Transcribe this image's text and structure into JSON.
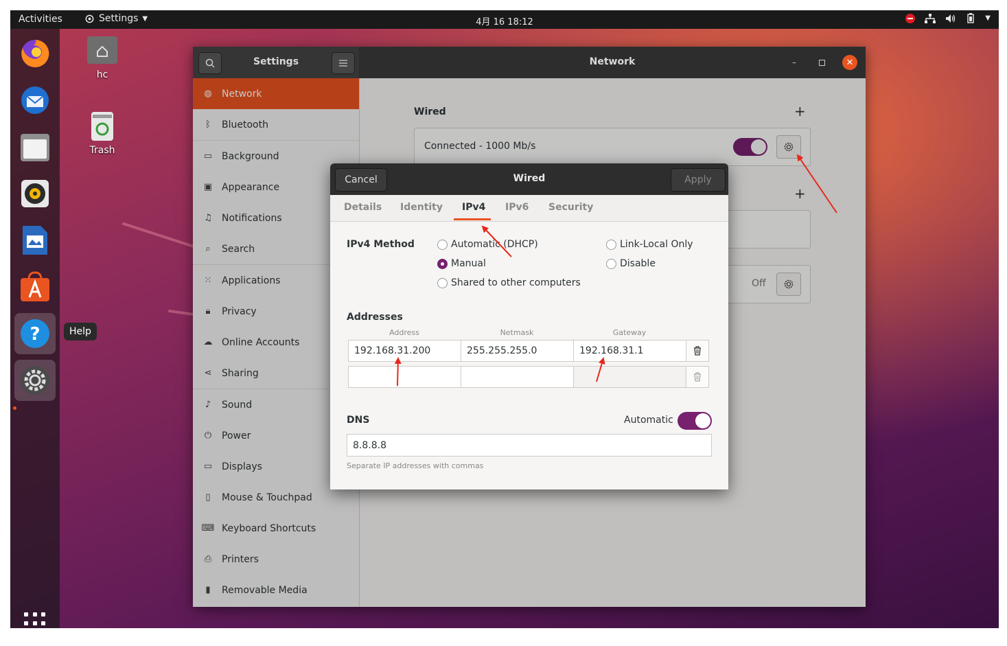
{
  "topbar": {
    "activities": "Activities",
    "app_menu": "Settings",
    "clock": "4月 16  18:12"
  },
  "dock": {
    "tooltip": "Help"
  },
  "desktop": {
    "home_label": "hc",
    "trash_label": "Trash"
  },
  "settings": {
    "sidebar_title": "Settings",
    "panel_title": "Network",
    "sidebar_items": [
      {
        "label": "Network",
        "icon": "network-icon"
      },
      {
        "label": "Bluetooth",
        "icon": "bluetooth-icon"
      },
      {
        "label": "Background",
        "icon": "background-icon"
      },
      {
        "label": "Appearance",
        "icon": "appearance-icon"
      },
      {
        "label": "Notifications",
        "icon": "bell-icon"
      },
      {
        "label": "Search",
        "icon": "search-icon"
      },
      {
        "label": "Applications",
        "icon": "apps-icon"
      },
      {
        "label": "Privacy",
        "icon": "lock-icon"
      },
      {
        "label": "Online Accounts",
        "icon": "cloud-icon"
      },
      {
        "label": "Sharing",
        "icon": "share-icon"
      },
      {
        "label": "Sound",
        "icon": "music-note-icon"
      },
      {
        "label": "Power",
        "icon": "power-icon"
      },
      {
        "label": "Displays",
        "icon": "display-icon"
      },
      {
        "label": "Mouse & Touchpad",
        "icon": "mouse-icon"
      },
      {
        "label": "Keyboard Shortcuts",
        "icon": "keyboard-icon"
      },
      {
        "label": "Printers",
        "icon": "printer-icon"
      },
      {
        "label": "Removable Media",
        "icon": "usb-icon"
      }
    ],
    "wired_title": "Wired",
    "wired_status": "Connected - 1000 Mb/s",
    "proxy_status": "Off"
  },
  "dialog": {
    "title": "Wired",
    "cancel": "Cancel",
    "apply": "Apply",
    "tabs": [
      "Details",
      "Identity",
      "IPv4",
      "IPv6",
      "Security"
    ],
    "active_tab": "IPv4",
    "ipv4_method_label": "IPv4 Method",
    "methods": {
      "automatic": "Automatic (DHCP)",
      "link_local": "Link-Local Only",
      "manual": "Manual",
      "disable": "Disable",
      "shared": "Shared to other computers"
    },
    "selected_method": "Manual",
    "addresses_label": "Addresses",
    "columns": {
      "address": "Address",
      "netmask": "Netmask",
      "gateway": "Gateway"
    },
    "rows": [
      {
        "address": "192.168.31.200",
        "netmask": "255.255.255.0",
        "gateway": "192.168.31.1"
      },
      {
        "address": "",
        "netmask": "",
        "gateway": ""
      }
    ],
    "dns_label": "DNS",
    "dns_automatic_label": "Automatic",
    "dns_value": "8.8.8.8",
    "dns_hint": "Separate IP addresses with commas"
  },
  "colors": {
    "accent": "#e95420",
    "toggle": "#77216f",
    "annotation_arrow": "#e8281c"
  }
}
